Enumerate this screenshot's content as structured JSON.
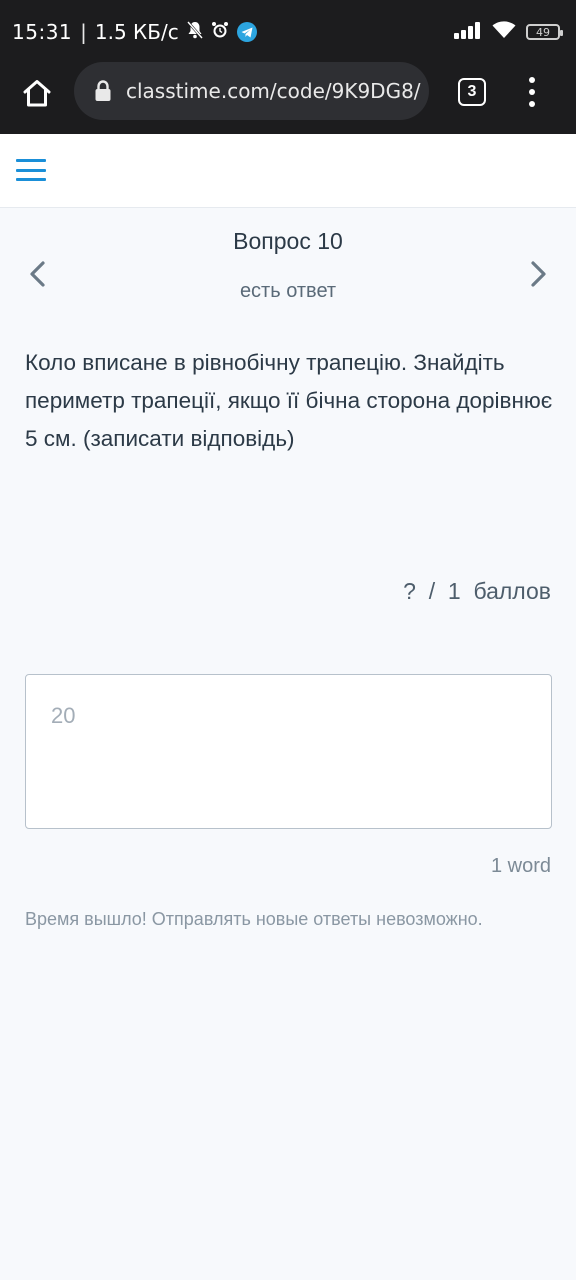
{
  "status_bar": {
    "time": "15:31",
    "separator": "|",
    "speed": "1.5 КБ/с",
    "battery": "49"
  },
  "browser": {
    "url": "classtime.com/code/9K9DG8/",
    "tab_count": "3"
  },
  "question": {
    "title": "Вопрос 10",
    "status": "есть ответ",
    "text": "Коло вписане в рівнобічну трапецію. Знайдіть периметр трапеції, якщо її бічна сторона дорівнює 5 см. (записати відповідь)",
    "score": "?  /  1  баллов"
  },
  "answer": {
    "value": "20",
    "word_count": "1 word"
  },
  "notice": "Время вышло! Отправлять новые ответы невозможно.",
  "colors": {
    "accent": "#1a8fd8",
    "text": "#2c3a47",
    "muted": "#8a97a3",
    "background": "#f7f9fc"
  },
  "icons": [
    "mute-bell-icon",
    "alarm-icon",
    "telegram-icon",
    "signal-icon",
    "wifi-icon",
    "battery-icon",
    "home-icon",
    "lock-icon",
    "tabs-icon",
    "more-vert-icon",
    "hamburger-menu-icon",
    "chevron-left-icon",
    "chevron-right-icon"
  ]
}
